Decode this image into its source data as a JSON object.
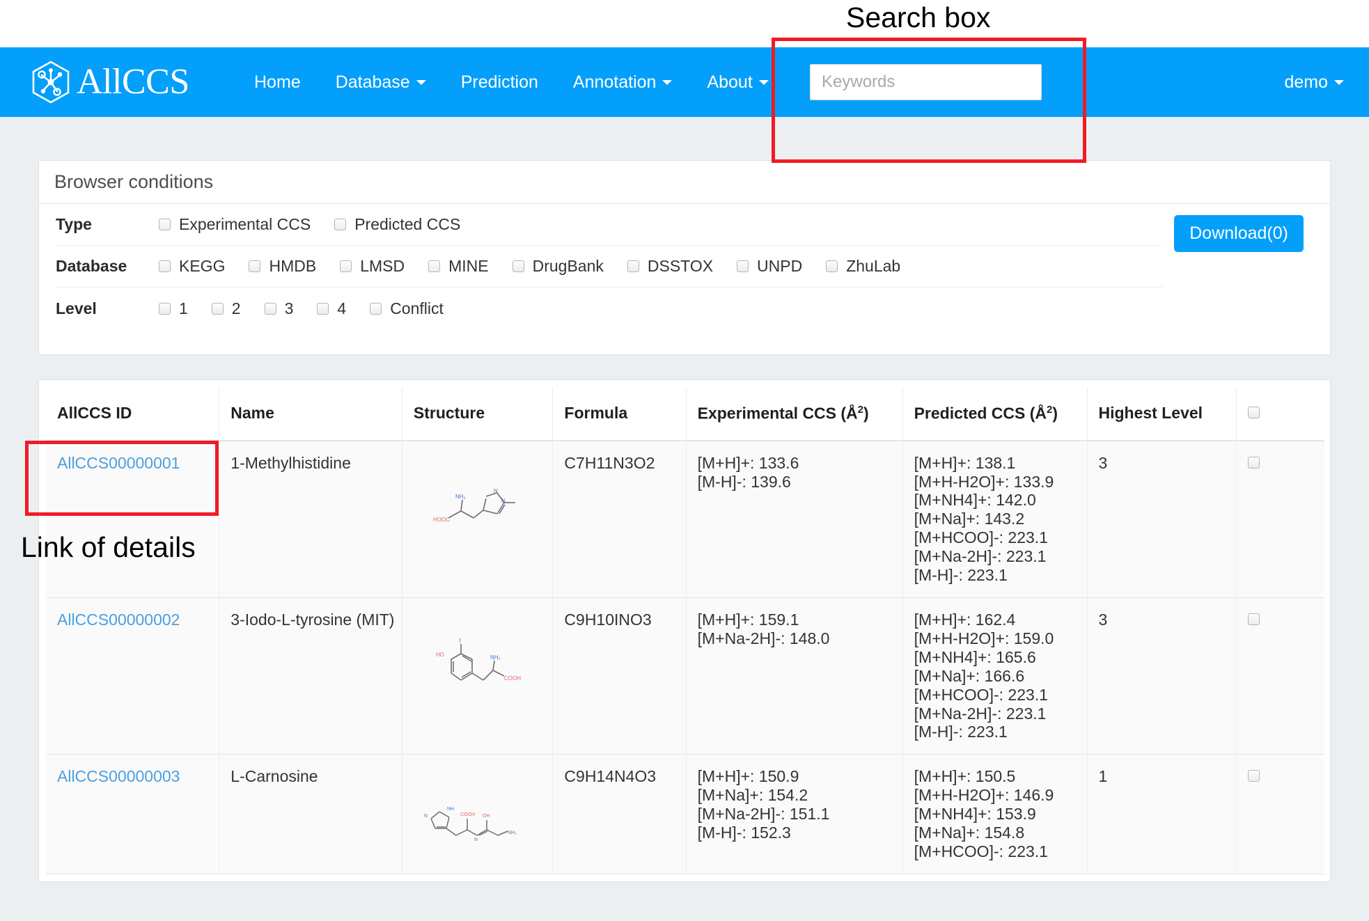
{
  "annotations": {
    "search_box_label": "Search box",
    "link_of_details_label": "Link of details",
    "highlight_color": "#ee1c25"
  },
  "navbar": {
    "brand": "AllCCS",
    "brand_icon": "hexagon-molecule-logo",
    "accent_color": "#039ffb",
    "links": [
      {
        "label": "Home",
        "has_caret": false
      },
      {
        "label": "Database",
        "has_caret": true
      },
      {
        "label": "Prediction",
        "has_caret": false
      },
      {
        "label": "Annotation",
        "has_caret": true
      },
      {
        "label": "About",
        "has_caret": true
      }
    ],
    "search": {
      "placeholder": "Keywords",
      "value": ""
    },
    "user": {
      "label": "demo",
      "has_caret": true
    }
  },
  "browser_conditions": {
    "title": "Browser conditions",
    "rows": [
      {
        "label": "Type",
        "options": [
          {
            "label": "Experimental CCS",
            "checked": false
          },
          {
            "label": "Predicted CCS",
            "checked": false
          }
        ]
      },
      {
        "label": "Database",
        "options": [
          {
            "label": "KEGG",
            "checked": false
          },
          {
            "label": "HMDB",
            "checked": false
          },
          {
            "label": "LMSD",
            "checked": false
          },
          {
            "label": "MINE",
            "checked": false
          },
          {
            "label": "DrugBank",
            "checked": false
          },
          {
            "label": "DSSTOX",
            "checked": false
          },
          {
            "label": "UNPD",
            "checked": false
          },
          {
            "label": "ZhuLab",
            "checked": false
          }
        ]
      },
      {
        "label": "Level",
        "options": [
          {
            "label": "1",
            "checked": false
          },
          {
            "label": "2",
            "checked": false
          },
          {
            "label": "3",
            "checked": false
          },
          {
            "label": "4",
            "checked": false
          },
          {
            "label": "Conflict",
            "checked": false
          }
        ]
      }
    ],
    "download_button": "Download(0)"
  },
  "results_table": {
    "columns": [
      {
        "key": "allccs_id",
        "label": "AllCCS ID"
      },
      {
        "key": "name",
        "label": "Name"
      },
      {
        "key": "structure",
        "label": "Structure"
      },
      {
        "key": "formula",
        "label": "Formula"
      },
      {
        "key": "experimental_ccs",
        "label": "Experimental CCS (Å",
        "sup": "2",
        "label_tail": ")"
      },
      {
        "key": "predicted_ccs",
        "label": "Predicted CCS (Å",
        "sup": "2",
        "label_tail": ")"
      },
      {
        "key": "highest_level",
        "label": "Highest Level"
      },
      {
        "key": "select",
        "label": ""
      }
    ],
    "select_all_checked": false,
    "rows": [
      {
        "allccs_id": "AllCCS00000001",
        "name": "1-Methylhistidine",
        "structure_icon": "1-methylhistidine-structure",
        "formula": "C7H11N3O2",
        "experimental_ccs": [
          "[M+H]+: 133.6",
          "[M-H]-: 139.6"
        ],
        "predicted_ccs": [
          "[M+H]+: 138.1",
          "[M+H-H2O]+: 133.9",
          "[M+NH4]+: 142.0",
          "[M+Na]+: 143.2",
          "[M+HCOO]-: 223.1",
          "[M+Na-2H]-: 223.1",
          "[M-H]-: 223.1"
        ],
        "highest_level": "3",
        "selected": false
      },
      {
        "allccs_id": "AllCCS00000002",
        "name": "3-Iodo-L-tyrosine (MIT)",
        "structure_icon": "3-iodo-l-tyrosine-structure",
        "formula": "C9H10INO3",
        "experimental_ccs": [
          "[M+H]+: 159.1",
          "[M+Na-2H]-: 148.0"
        ],
        "predicted_ccs": [
          "[M+H]+: 162.4",
          "[M+H-H2O]+: 159.0",
          "[M+NH4]+: 165.6",
          "[M+Na]+: 166.6",
          "[M+HCOO]-: 223.1",
          "[M+Na-2H]-: 223.1",
          "[M-H]-: 223.1"
        ],
        "highest_level": "3",
        "selected": false
      },
      {
        "allccs_id": "AllCCS00000003",
        "name": "L-Carnosine",
        "structure_icon": "l-carnosine-structure",
        "formula": "C9H14N4O3",
        "experimental_ccs": [
          "[M+H]+: 150.9",
          "[M+Na]+: 154.2",
          "[M+Na-2H]-: 151.1",
          "[M-H]-: 152.3"
        ],
        "predicted_ccs": [
          "[M+H]+: 150.5",
          "[M+H-H2O]+: 146.9",
          "[M+NH4]+: 153.9",
          "[M+Na]+: 154.8",
          "[M+HCOO]-: 223.1"
        ],
        "highest_level": "1",
        "selected": false
      }
    ]
  }
}
